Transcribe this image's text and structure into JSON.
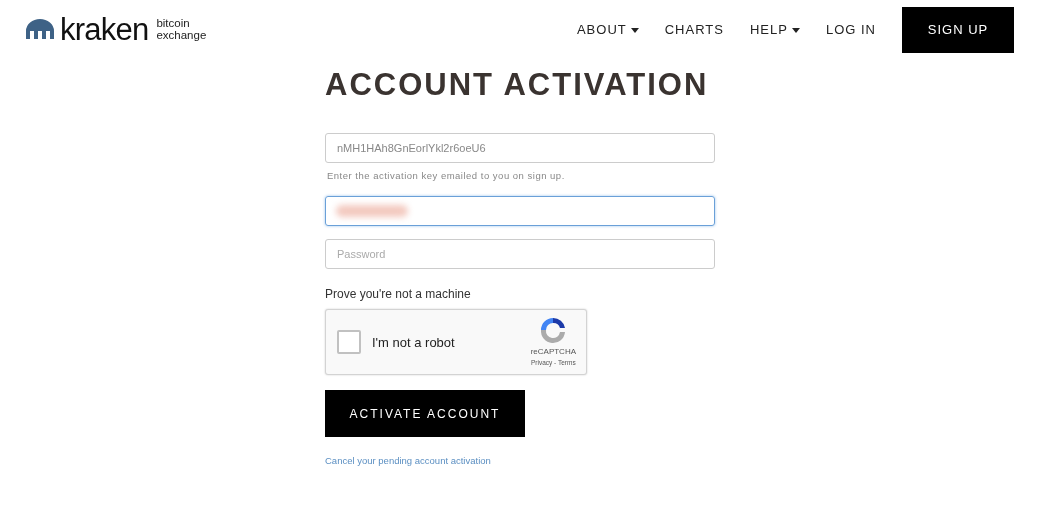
{
  "logo": {
    "name": "kraken",
    "tagline_1": "bitcoin",
    "tagline_2": "exchange"
  },
  "nav": [
    {
      "label": "ABOUT",
      "dropdown": true
    },
    {
      "label": "CHARTS",
      "dropdown": false
    },
    {
      "label": "HELP",
      "dropdown": true
    },
    {
      "label": "LOG IN",
      "dropdown": false
    }
  ],
  "signup_button": "SIGN UP",
  "title": "ACCOUNT ACTIVATION",
  "key_field": {
    "value": "nMH1HAh8GnEorlYkl2r6oeU6",
    "hint": "Enter the activation key emailed to you on sign up."
  },
  "email_field": {
    "focused": true,
    "redacted": true
  },
  "password_field": {
    "placeholder": "Password"
  },
  "captcha": {
    "prompt": "Prove you're not a machine",
    "label": "I'm not a robot",
    "checked": false,
    "brand": "reCAPTCHA",
    "links": "Privacy - Terms"
  },
  "submit_button": "ACTIVATE ACCOUNT",
  "cancel_link": "Cancel your pending account activation"
}
